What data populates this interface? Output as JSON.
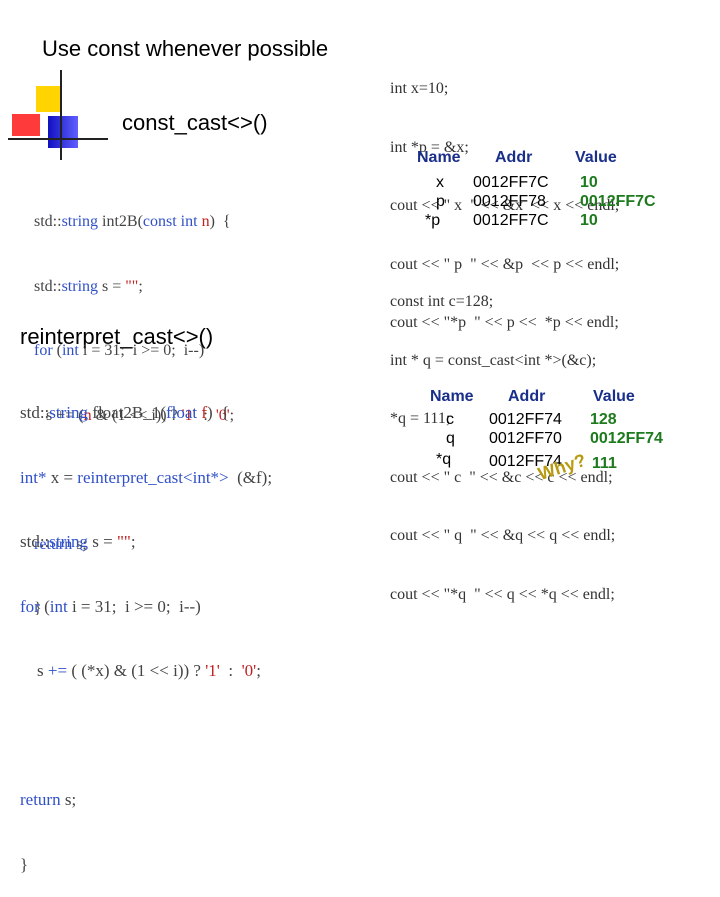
{
  "title": "Use const whenever possible",
  "heading_const_cast": "const_cast<>()",
  "heading_reinterpret_cast": "reinterpret_cast<>()",
  "decoration": {
    "colors": [
      "#ffd400",
      "#ff3030",
      "#2020d0"
    ]
  },
  "code_right_top": [
    "int x=10;",
    "int *p = &x;",
    "cout << \" x  \" << &x  << x << endl;",
    "cout << \" p  \" << &p  << p << endl;",
    "cout << \"*p  \" << p <<  *p << endl;"
  ],
  "table1": {
    "headers": [
      "Name",
      "Addr",
      "Value"
    ],
    "rows": [
      [
        "x",
        "0012FF7C",
        "10"
      ],
      [
        "p",
        "0012FF78",
        "0012FF7C"
      ],
      [
        "*p",
        "0012FF7C",
        "10"
      ]
    ]
  },
  "int2b": {
    "l1_a": "std::",
    "l1_b": "string",
    "l1_c": " int2B(",
    "l1_d": "const int",
    "l1_e": " n",
    "l1_f": ")  {",
    "l2_a": "std::",
    "l2_b": "string",
    "l2_c": " s = ",
    "l2_d": "\"\"",
    "l2_e": ";",
    "l3_a": "for",
    "l3_b": " (",
    "l3_c": "int",
    "l3_d": " i = 31;  i >= 0;  i--)",
    "l4_a": "   s += (",
    "l4_b": "n",
    "l4_c": " & (1 << i)) ? ",
    "l4_d": "'1'",
    "l4_e": "  :  ",
    "l4_f": "'0'",
    "l4_g": ";",
    "l5_a": "return",
    "l5_b": " s;",
    "l6": "}"
  },
  "code_right_mid": [
    "const int c=128;",
    "int * q = const_cast<int *>(&c);",
    "*q = 111;",
    "cout << \" c  \" << &c << c << endl;",
    "cout << \" q  \" << &q << q << endl;",
    "cout << \"*q  \" << q << *q << endl;"
  ],
  "float2b": {
    "l1_a": "std::",
    "l1_b": "string",
    "l1_c": " float2B_1(",
    "l1_d": "float",
    "l1_e": " f",
    "l1_f": ")  {",
    "l2_a": "int*",
    "l2_b": " x = ",
    "l2_c": "reinterpret_cast",
    "l2_d": "<int*>",
    "l2_e": "  (&f);",
    "l3_a": "std::",
    "l3_b": "string",
    "l3_c": " s = ",
    "l3_d": "\"\"",
    "l3_e": ";",
    "l4_a": "for",
    "l4_b": " (",
    "l4_c": "int",
    "l4_d": " i = 31;  i >= 0;  i--)",
    "l5_a": "    s ",
    "l5_b": "+=",
    "l5_c": " ( (*x) & (1 << i)) ? ",
    "l5_d": "'1'",
    "l5_e": "  :  ",
    "l5_f": "'0'",
    "l5_g": ";",
    "l6_a": "return",
    "l6_b": " s;",
    "l7": "}"
  },
  "table2": {
    "headers": [
      "Name",
      "Addr",
      "Value"
    ],
    "rows": [
      [
        "c",
        "0012FF74",
        "128"
      ],
      [
        "q",
        "0012FF70",
        "0012FF74"
      ],
      [
        "*q",
        "0012FF74",
        "111"
      ]
    ]
  },
  "annotation": "Why?"
}
